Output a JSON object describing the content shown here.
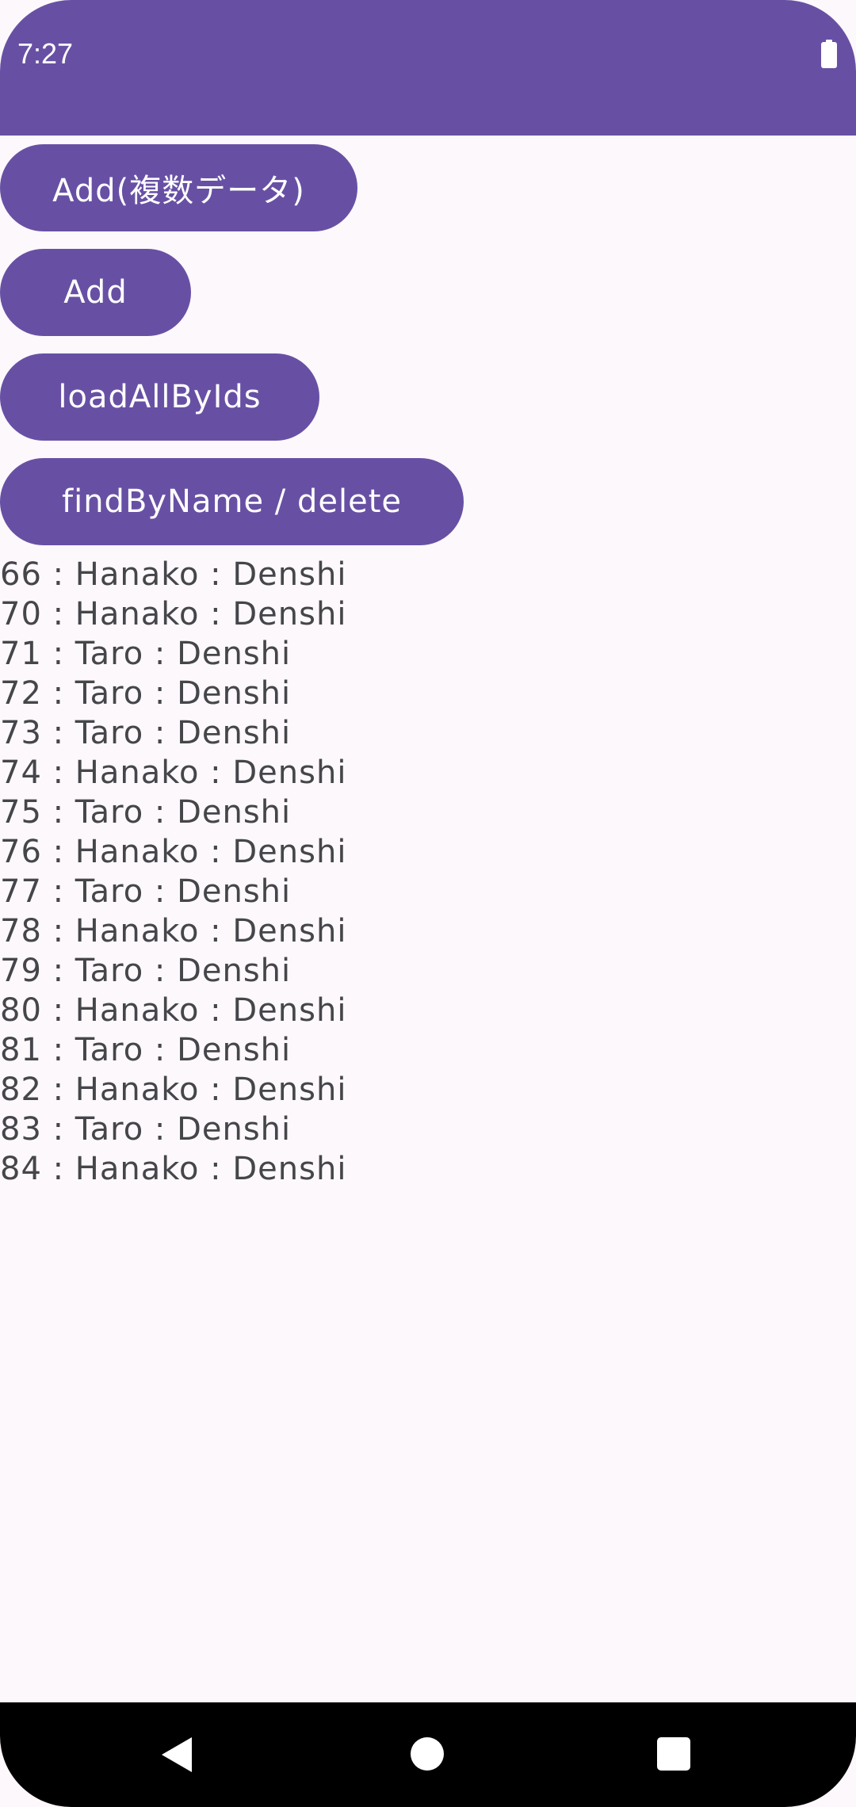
{
  "status_bar": {
    "time": "7:27",
    "battery_icon": "battery-full-icon",
    "background": "#6750a4"
  },
  "buttons": {
    "add_multi": "Add(複数データ)",
    "add": "Add",
    "load_all_by_ids": "loadAllByIds",
    "find_by_name_delete": "findByName / delete"
  },
  "results": [
    "66 : Hanako : Denshi",
    "70 : Hanako : Denshi",
    "71 : Taro : Denshi",
    "72 : Taro : Denshi",
    "73 : Taro : Denshi",
    "74 : Hanako : Denshi",
    "75 : Taro : Denshi",
    "76 : Hanako : Denshi",
    "77 : Taro : Denshi",
    "78 : Hanako : Denshi",
    "79 : Taro : Denshi",
    "80 : Hanako : Denshi",
    "81 : Taro : Denshi",
    "82 : Hanako : Denshi",
    "83 : Taro : Denshi",
    "84 : Hanako : Denshi"
  ],
  "nav_bar": {
    "back_icon": "back-triangle-icon",
    "home_icon": "home-circle-icon",
    "recents_icon": "recents-square-icon"
  },
  "colors": {
    "primary": "#6750a4",
    "background": "#fdf8fc",
    "text": "#45464a"
  }
}
